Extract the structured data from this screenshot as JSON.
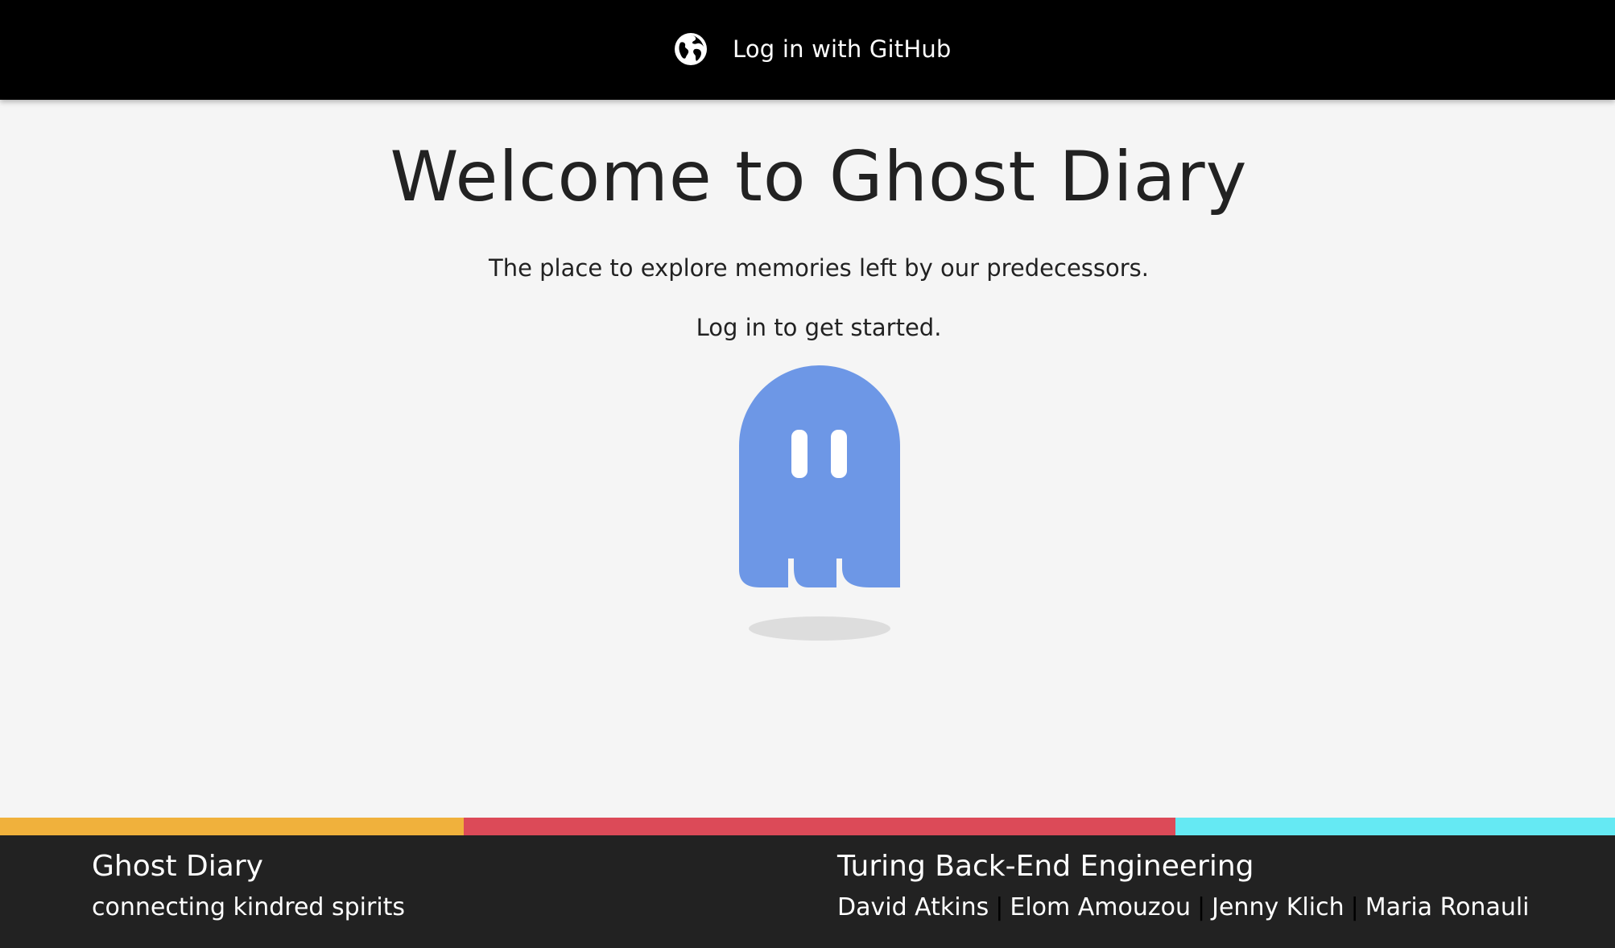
{
  "header": {
    "login_label": "Log in with GitHub",
    "login_icon": "globe-icon",
    "background": "#000000"
  },
  "main": {
    "title": "Welcome to Ghost Diary",
    "tagline": "The place to explore memories left by our predecessors.",
    "cta": "Log in to get started.",
    "ghost_color": "#6d97e6"
  },
  "stripes": [
    "#f0b13c",
    "#dc4a58",
    "#65e9f3"
  ],
  "footer": {
    "app_name": "Ghost Diary",
    "app_tagline": "connecting kindred spirits",
    "org": "Turing Back-End Engineering",
    "team": [
      {
        "name": "David Atkins"
      },
      {
        "name": "Elom Amouzou"
      },
      {
        "name": "Jenny Klich"
      },
      {
        "name": "Maria Ronauli"
      }
    ],
    "separator": "|"
  }
}
